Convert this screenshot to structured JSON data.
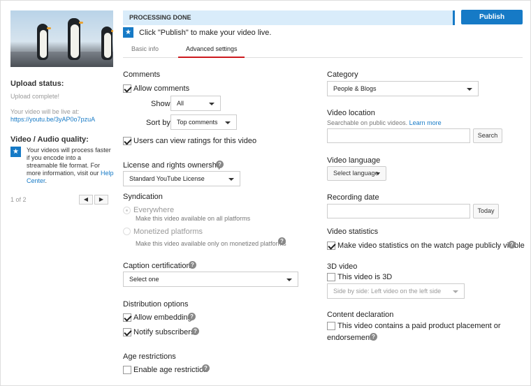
{
  "status": {
    "processing": "PROCESSING DONE",
    "publish": "Publish",
    "hint": "Click \"Publish\" to make your video live."
  },
  "tabs": [
    "Basic info",
    "Advanced settings"
  ],
  "sidebar": {
    "upload_status_title": "Upload status:",
    "upload_complete": "Upload complete!",
    "live_at": "Your video will be live at:",
    "url": "https://youtu.be/3yAP0o7pzuA",
    "quality_title": "Video / Audio quality:",
    "quality_text": "Your videos will process faster if you encode into a streamable file format. For more information, visit our ",
    "help_center": "Help Center",
    "quality_period": ".",
    "pager": "1 of 2",
    "prev": "◀",
    "next": "▶"
  },
  "comments": {
    "title": "Comments",
    "allow": "Allow comments",
    "show_label": "Show",
    "show_value": "All",
    "sort_label": "Sort by",
    "sort_value": "Top comments",
    "ratings": "Users can view ratings for this video"
  },
  "license": {
    "title": "License and rights ownership",
    "value": "Standard YouTube License"
  },
  "syndication": {
    "title": "Syndication",
    "everywhere": "Everywhere",
    "everywhere_desc": "Make this video available on all platforms",
    "monetized": "Monetized platforms",
    "monetized_desc": "Make this video available only on monetized platforms"
  },
  "caption": {
    "title": "Caption certification",
    "value": "Select one"
  },
  "distribution": {
    "title": "Distribution options",
    "embedding": "Allow embedding",
    "notify": "Notify subscribers"
  },
  "age": {
    "title": "Age restrictions",
    "enable": "Enable age restriction"
  },
  "category": {
    "title": "Category",
    "value": "People & Blogs"
  },
  "location": {
    "title": "Video location",
    "desc": "Searchable on public videos.",
    "learn_more": "Learn more",
    "search": "Search"
  },
  "language": {
    "title": "Video language",
    "value": "Select language"
  },
  "recording": {
    "title": "Recording date",
    "today": "Today"
  },
  "stats": {
    "title": "Video statistics",
    "make_visible": "Make video statistics on the watch page publicly visible"
  },
  "video3d": {
    "title": "3D video",
    "is3d": "This video is 3D",
    "mode": "Side by side: Left video on the left side"
  },
  "content": {
    "title": "Content declaration",
    "paid_line1": "This video contains a paid product placement or",
    "paid_line2": "endorsement"
  },
  "help_glyph": "?",
  "star_glyph": "★",
  "colors": {
    "accent": "#167ac6",
    "tab_underline": "#cc181e",
    "processing_bg": "#d9ecfa"
  }
}
